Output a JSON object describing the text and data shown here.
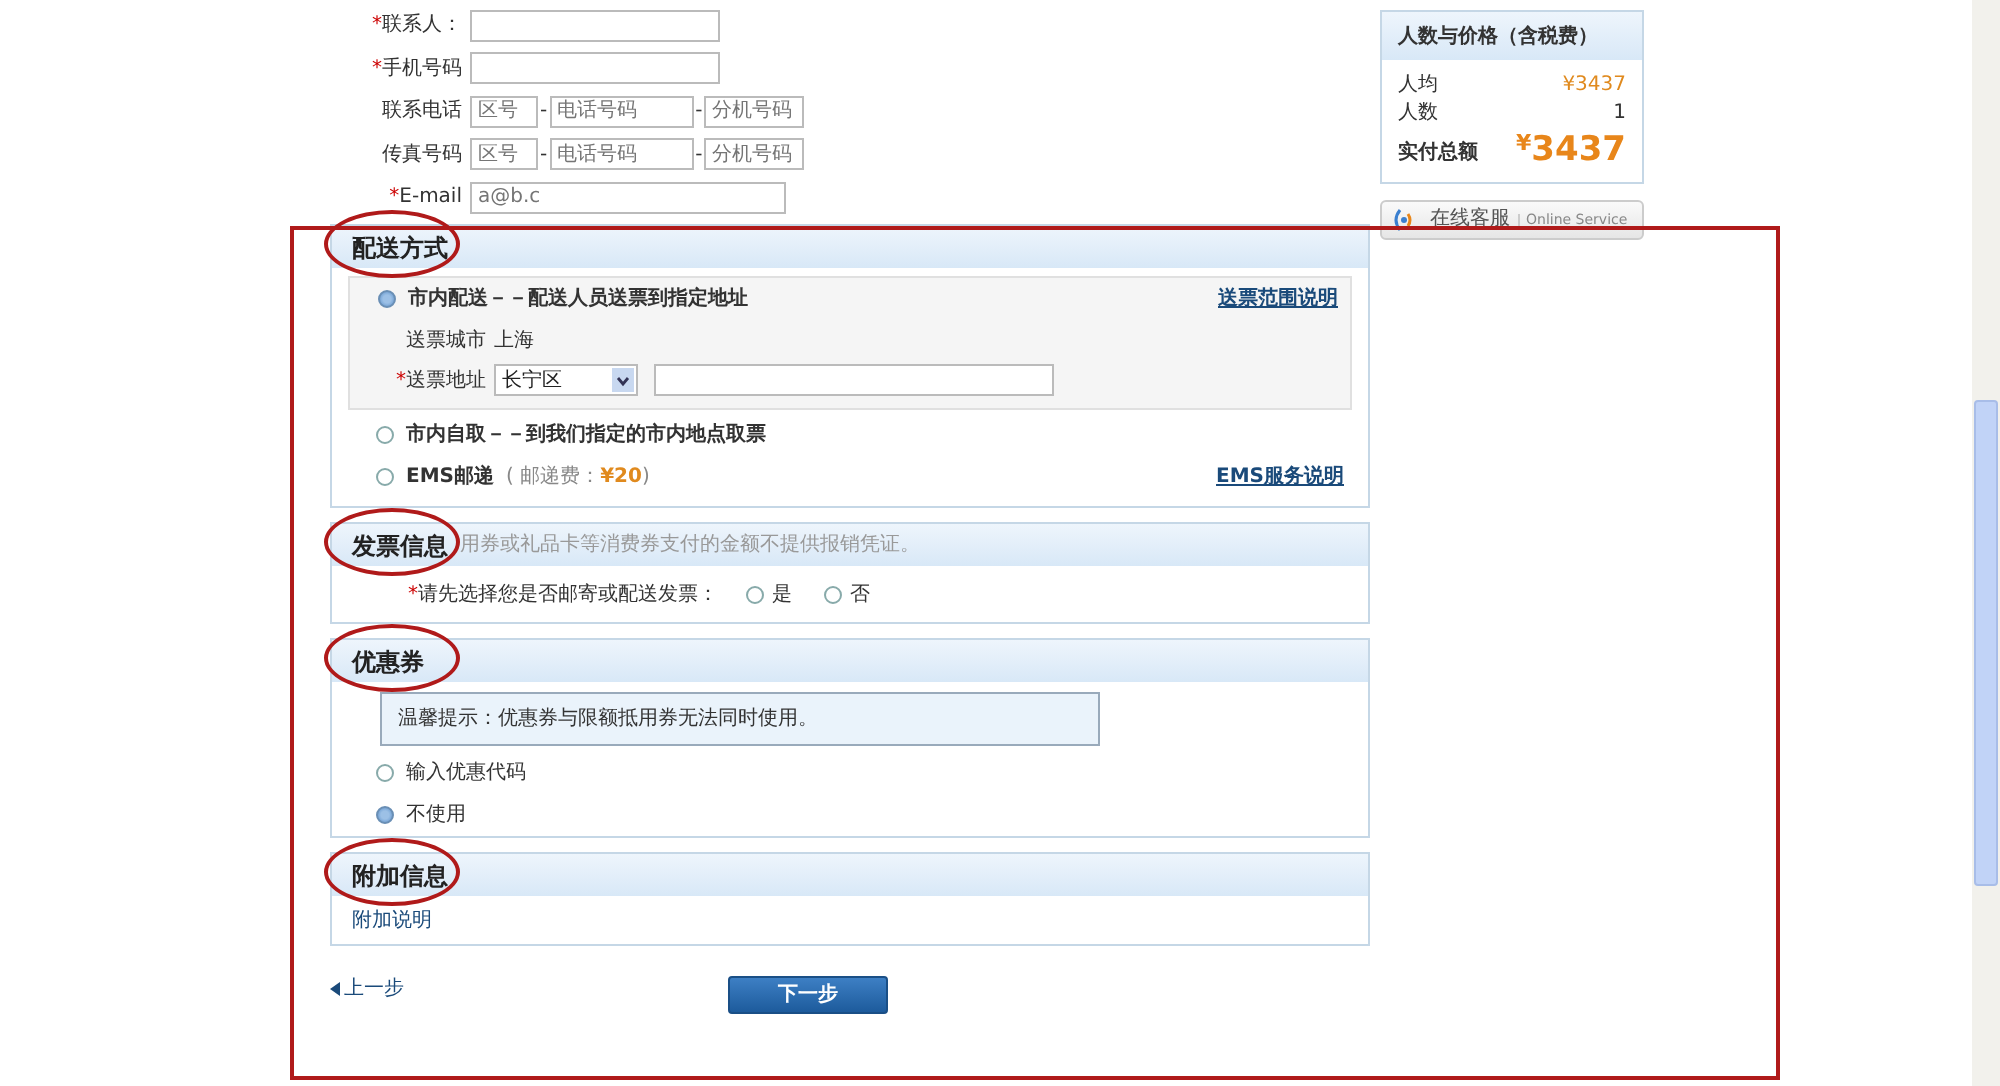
{
  "contact_form": {
    "fields": [
      {
        "kind": "text",
        "mark": "*",
        "label": "联系人："
      },
      {
        "kind": "text",
        "mark": "*",
        "label": "手机号码"
      },
      {
        "kind": "phone",
        "label": "联系电话",
        "separator": "-",
        "placeholders": [
          "区号",
          "电话号码",
          "分机号码"
        ]
      },
      {
        "kind": "phone",
        "label": "传真号码",
        "separator": "-",
        "placeholders": [
          "区号",
          "电话号码",
          "分机号码"
        ]
      },
      {
        "kind": "email",
        "mark": "*",
        "label": "E-mail",
        "placeholder": "a@b.c"
      }
    ]
  },
  "delivery": {
    "title": "配送方式",
    "circled": true,
    "options": [
      {
        "label": "市内配送－－配送人员送票到指定地址",
        "selected": true,
        "link": "送票范围说明",
        "details": {
          "city_label": "送票城市",
          "city": "上海",
          "address_mark": "*",
          "address_label": "送票地址",
          "district": "长宁区"
        }
      },
      {
        "label": "市内自取－－到我们指定的市内地点取票",
        "selected": false
      },
      {
        "label": "EMS邮递",
        "note_prefix": "( 邮递费：",
        "fee": "¥20",
        "note_suffix": ")",
        "selected": false,
        "link": "EMS服务说明"
      }
    ]
  },
  "invoice": {
    "title": "发票信息",
    "circled": true,
    "note": "用券或礼品卡等消费券支付的金额不提供报销凭证。",
    "question_mark": "*",
    "question": "请先选择您是否邮寄或配送发票：",
    "options": [
      {
        "label": "是",
        "selected": false
      },
      {
        "label": "否",
        "selected": false
      }
    ]
  },
  "coupon": {
    "title": "优惠券",
    "circled": true,
    "tip": "温馨提示：优惠券与限额抵用券无法同时使用。",
    "options": [
      {
        "label": "输入优惠代码",
        "selected": false
      },
      {
        "label": "不使用",
        "selected": true
      }
    ]
  },
  "extra": {
    "title": "附加信息",
    "circled": true,
    "link": "附加说明"
  },
  "navigation": {
    "prev": "上一步",
    "next": "下一步"
  },
  "price_panel": {
    "title": "人数与价格（含税费）",
    "rows": [
      {
        "label": "人均",
        "value": "¥3437",
        "kind": "price"
      },
      {
        "label": "人数",
        "value": "1",
        "kind": "plain"
      }
    ],
    "total_label": "实付总额",
    "currency": "¥",
    "total": "3437"
  },
  "online_service": {
    "label": "在线客服",
    "sublabel": "Online Service"
  },
  "annotation_frame": true
}
